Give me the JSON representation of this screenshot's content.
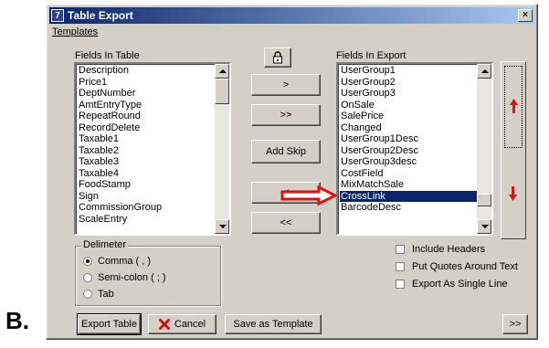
{
  "figure_letter": "B.",
  "window": {
    "title": "Table Export",
    "close_label": "×"
  },
  "menu": {
    "templates": "Templates"
  },
  "fields_in_table": {
    "label": "Fields In Table",
    "items": [
      "Description",
      "Price1",
      "DeptNumber",
      "AmtEntryType",
      "RepeatRound",
      "RecordDelete",
      "Taxable1",
      "Taxable2",
      "Taxable3",
      "Taxable4",
      "FoodStamp",
      "Sign",
      "CommissionGroup",
      "ScaleEntry"
    ]
  },
  "fields_in_export": {
    "label": "Fields In Export",
    "items": [
      "UserGroup1",
      "UserGroup2",
      "UserGroup3",
      "OnSale",
      "SalePrice",
      "Changed",
      "UserGroup1Desc",
      "UserGroup2Desc",
      "UserGroup3desc",
      "CostField",
      "MixMatchSale",
      "CrossLink",
      "BarcodeDesc"
    ],
    "selected": "CrossLink"
  },
  "buttons": {
    "add_one": ">",
    "add_all": ">>",
    "add_skip": "Add Skip",
    "remove_one": "<",
    "remove_all": "<<",
    "export_table": "Export Table",
    "cancel": "Cancel",
    "save_template": "Save as Template",
    "more": ">>"
  },
  "delimiter": {
    "label": "Delimeter",
    "options": [
      "Comma ( , )",
      "Semi-colon ( ; )",
      "Tab"
    ],
    "selected": "Comma ( , )"
  },
  "options": {
    "include_headers": "Include Headers",
    "put_quotes": "Put Quotes Around Text",
    "single_line": "Export As Single Line"
  },
  "colors": {
    "annotation_arrow": "#e01010",
    "order_arrows": "#d01818",
    "selection": "#0a246a"
  }
}
